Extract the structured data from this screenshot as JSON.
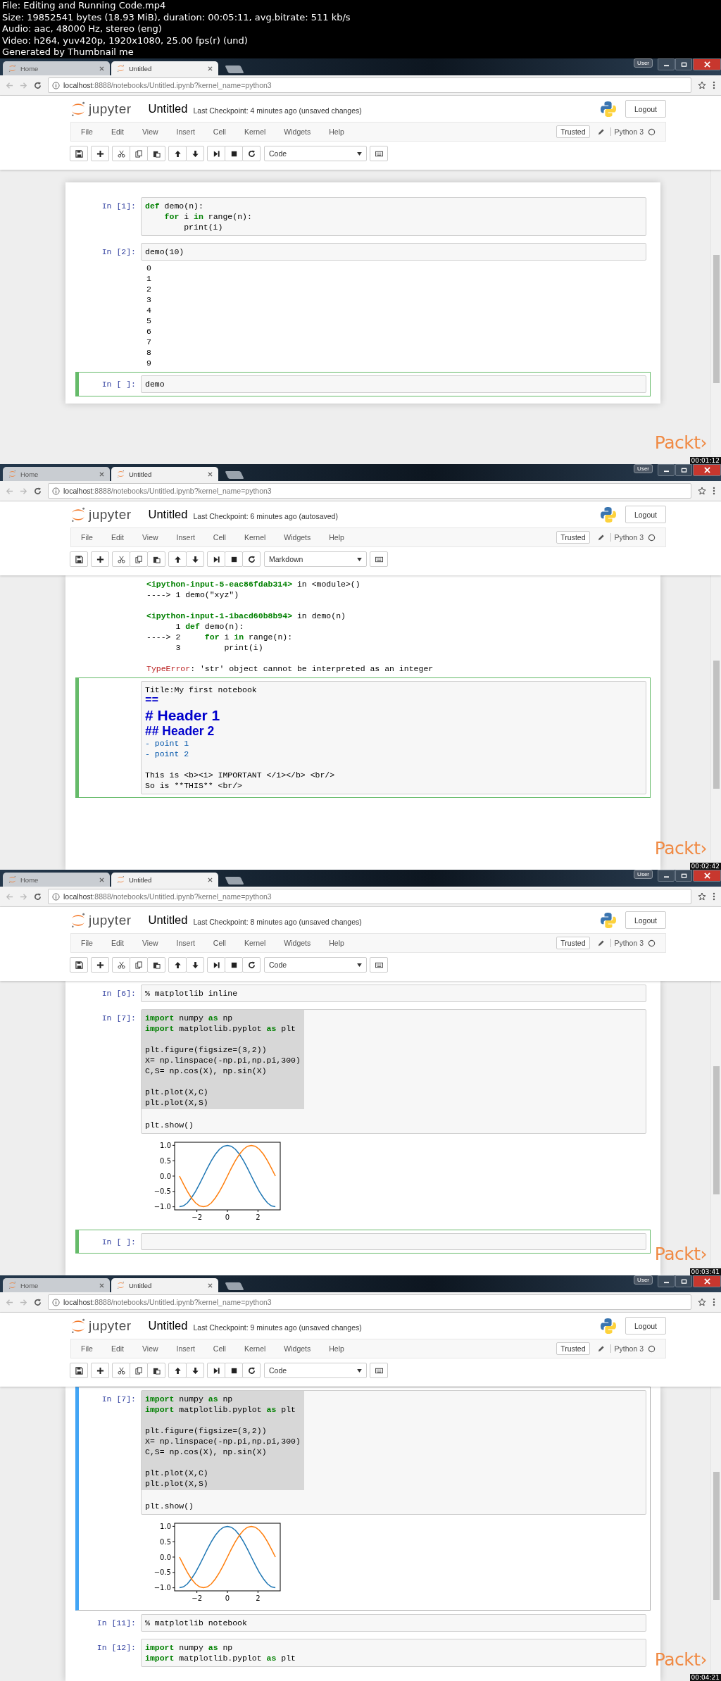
{
  "video_info": [
    "File: Editing and Running Code.mp4",
    "Size: 19852541 bytes (18.93 MiB), duration: 00:05:11, avg.bitrate: 511 kb/s",
    "Audio: aac, 48000 Hz, stereo (eng)",
    "Video: h264, yuv420p, 1920x1080, 25.00 fps(r) (und)",
    "Generated by Thumbnail me"
  ],
  "frames": [
    {
      "tabs": [
        {
          "label": "Home",
          "selected": false
        },
        {
          "label": "Untitled",
          "selected": true
        }
      ],
      "user_badge": "User",
      "url_host": "localhost",
      "url_rest": ":8888/notebooks/Untitled.ipynb?kernel_name=python3",
      "logo_text": "jupyter",
      "notebook_title": "Untitled",
      "checkpoint": "Last Checkpoint: 4 minutes ago (unsaved changes)",
      "logout": "Logout",
      "menu": [
        "File",
        "Edit",
        "View",
        "Insert",
        "Cell",
        "Kernel",
        "Widgets",
        "Help"
      ],
      "trusted": "Trusted",
      "kernel": "Python 3",
      "cell_type": "Code",
      "at_top": true,
      "cells": [
        {
          "prompt": "In [1]:",
          "selected": false,
          "input": {
            "kind": "code",
            "blocks": [
              [
                "**def** demo(n):",
                "    **for** i **in** range(n):",
                "        print(i)"
              ]
            ]
          }
        },
        {
          "prompt": "In [2]:",
          "selected": false,
          "input": {
            "kind": "code",
            "blocks": [
              [
                "demo(10)"
              ]
            ]
          },
          "output": {
            "kind": "stream",
            "lines": [
              "0",
              "1",
              "2",
              "3",
              "4",
              "5",
              "6",
              "7",
              "8",
              "9"
            ]
          }
        },
        {
          "prompt": "In [ ]:",
          "selected": true,
          "edit_mode": true,
          "input": {
            "kind": "code",
            "blocks": [
              [
                "demo"
              ]
            ]
          }
        }
      ],
      "brand": "Packt›",
      "timestamp": "00:01:12"
    },
    {
      "tabs": [
        {
          "label": "Home",
          "selected": false
        },
        {
          "label": "Untitled",
          "selected": true
        }
      ],
      "user_badge": "User",
      "url_host": "localhost",
      "url_rest": ":8888/notebooks/Untitled.ipynb?kernel_name=python3",
      "logo_text": "jupyter",
      "notebook_title": "Untitled",
      "checkpoint": "Last Checkpoint: 6 minutes ago (autosaved)",
      "logout": "Logout",
      "menu": [
        "File",
        "Edit",
        "View",
        "Insert",
        "Cell",
        "Kernel",
        "Widgets",
        "Help"
      ],
      "trusted": "Trusted",
      "kernel": "Python 3",
      "cell_type": "Markdown",
      "at_top": false,
      "cells": [
        {
          "selected": false,
          "output": {
            "kind": "traceback",
            "blocks": [
              [
                "**<ipython-input-5-eac86fdab314>** in <module>()",
                "----> 1 demo(\"xyz\")"
              ],
              [
                "**<ipython-input-1-1bacd60b8b94>** in demo(n)",
                "      1 **def** demo(n):",
                "----> 2     **for** i **in** range(n):",
                "      3         print(i)"
              ]
            ],
            "error_name": "TypeError",
            "error_message": ": 'str' object cannot be interpreted as an integer"
          }
        },
        {
          "selected": true,
          "edit_mode": true,
          "input": {
            "kind": "markdown",
            "blocks": [
              [
                {
                  "text": "Title:My first notebook",
                  "kind": "plain"
                },
                {
                  "text": "==",
                  "kind": "setext"
                },
                {
                  "text": "# Header 1",
                  "kind": "h1"
                },
                {
                  "text": "## Header 2",
                  "kind": "h2"
                },
                {
                  "text": "- point 1",
                  "kind": "list"
                },
                {
                  "text": "- point 2",
                  "kind": "list"
                }
              ],
              [
                {
                  "text": "This is <b><i> IMPORTANT </i></b> <br/>",
                  "kind": "plain"
                },
                {
                  "text": "So is **THIS** <br/>",
                  "kind": "plain"
                }
              ]
            ]
          }
        }
      ],
      "brand": "Packt›",
      "timestamp": "00:02:42"
    },
    {
      "tabs": [
        {
          "label": "Home",
          "selected": false
        },
        {
          "label": "Untitled",
          "selected": true
        }
      ],
      "user_badge": "User",
      "url_host": "localhost",
      "url_rest": ":8888/notebooks/Untitled.ipynb?kernel_name=python3",
      "logo_text": "jupyter",
      "notebook_title": "Untitled",
      "checkpoint": "Last Checkpoint: 8 minutes ago (unsaved changes)",
      "logout": "Logout",
      "menu": [
        "File",
        "Edit",
        "View",
        "Insert",
        "Cell",
        "Kernel",
        "Widgets",
        "Help"
      ],
      "trusted": "Trusted",
      "kernel": "Python 3",
      "cell_type": "Code",
      "at_top": false,
      "cells": [
        {
          "prompt": "In [6]:",
          "selected": false,
          "input": {
            "kind": "code",
            "blocks": [
              [
                "% matplotlib inline"
              ]
            ]
          }
        },
        {
          "prompt": "In [7]:",
          "selected": false,
          "input": {
            "kind": "code",
            "highlighted_blocks": [
              [
                "**import** numpy **as** np",
                "**import** matplotlib.pyplot **as** plt"
              ],
              [
                "plt.figure(figsize=(3,2))",
                "X= np.linspace(-np.pi,np.pi,300)",
                "C,S= np.cos(X), np.sin(X)"
              ],
              [
                "plt.plot(X,C)",
                "plt.plot(X,S)"
              ]
            ],
            "blocks": [
              [
                "plt.show()"
              ]
            ]
          },
          "output": {
            "kind": "chart",
            "chart_data": {
              "type": "line",
              "x": [
                -3.14,
                -2.88,
                -2.62,
                -2.36,
                -2.09,
                -1.83,
                -1.57,
                -1.31,
                -1.05,
                -0.79,
                -0.52,
                -0.26,
                0,
                0.26,
                0.52,
                0.79,
                1.05,
                1.31,
                1.57,
                1.83,
                2.09,
                2.36,
                2.62,
                2.88,
                3.14
              ],
              "series": [
                {
                  "color": "#1f77b4",
                  "values": [
                    -1,
                    -0.97,
                    -0.87,
                    -0.71,
                    -0.5,
                    -0.26,
                    0,
                    0.26,
                    0.5,
                    0.71,
                    0.87,
                    0.97,
                    1,
                    0.97,
                    0.87,
                    0.71,
                    0.5,
                    0.26,
                    0,
                    -0.26,
                    -0.5,
                    -0.71,
                    -0.87,
                    -0.97,
                    -1
                  ]
                },
                {
                  "color": "#ff7f0e",
                  "values": [
                    0,
                    -0.26,
                    -0.5,
                    -0.71,
                    -0.87,
                    -0.97,
                    -1,
                    -0.97,
                    -0.87,
                    -0.71,
                    -0.5,
                    -0.26,
                    0,
                    0.26,
                    0.5,
                    0.71,
                    0.87,
                    0.97,
                    1,
                    0.97,
                    0.87,
                    0.71,
                    0.5,
                    0.26,
                    0
                  ]
                }
              ],
              "xlim": [
                -3.46,
                3.46
              ],
              "ylim": [
                -1.1,
                1.1
              ],
              "xticks": [
                {
                  "value": -2,
                  "label": "−2"
                },
                {
                  "value": 0,
                  "label": "0"
                },
                {
                  "value": 2,
                  "label": "2"
                }
              ],
              "yticks": [
                {
                  "value": 1,
                  "label": "1.0"
                },
                {
                  "value": 0.5,
                  "label": "0.5"
                },
                {
                  "value": 0,
                  "label": "0.0"
                },
                {
                  "value": -0.5,
                  "label": "−0.5"
                },
                {
                  "value": -1,
                  "label": "−1.0"
                }
              ]
            }
          }
        },
        {
          "prompt": "In [ ]:",
          "selected": true,
          "edit_mode": true,
          "input": {
            "kind": "code"
          }
        }
      ],
      "brand": "Packt›",
      "timestamp": "00:03:41"
    },
    {
      "tabs": [
        {
          "label": "Home",
          "selected": false
        },
        {
          "label": "Untitled",
          "selected": true
        }
      ],
      "user_badge": "User",
      "url_host": "localhost",
      "url_rest": ":8888/notebooks/Untitled.ipynb?kernel_name=python3",
      "logo_text": "jupyter",
      "notebook_title": "Untitled",
      "checkpoint": "Last Checkpoint: 9 minutes ago (unsaved changes)",
      "logout": "Logout",
      "menu": [
        "File",
        "Edit",
        "View",
        "Insert",
        "Cell",
        "Kernel",
        "Widgets",
        "Help"
      ],
      "trusted": "Trusted",
      "kernel": "Python 3",
      "cell_type": "Code",
      "at_top": false,
      "cells": [
        {
          "prompt": "In [7]:",
          "selected": true,
          "edit_mode": false,
          "input": {
            "kind": "code",
            "highlighted_blocks": [
              [
                "**import** numpy **as** np",
                "**import** matplotlib.pyplot **as** plt"
              ],
              [
                "plt.figure(figsize=(3,2))",
                "X= np.linspace(-np.pi,np.pi,300)",
                "C,S= np.cos(X), np.sin(X)"
              ],
              [
                "plt.plot(X,C)",
                "plt.plot(X,S)"
              ]
            ],
            "blocks": [
              [
                "plt.show()"
              ]
            ]
          },
          "output": {
            "kind": "chart",
            "chart_data": {
              "type": "line",
              "x": [
                -3.14,
                -2.88,
                -2.62,
                -2.36,
                -2.09,
                -1.83,
                -1.57,
                -1.31,
                -1.05,
                -0.79,
                -0.52,
                -0.26,
                0,
                0.26,
                0.52,
                0.79,
                1.05,
                1.31,
                1.57,
                1.83,
                2.09,
                2.36,
                2.62,
                2.88,
                3.14
              ],
              "series": [
                {
                  "color": "#1f77b4",
                  "values": [
                    -1,
                    -0.97,
                    -0.87,
                    -0.71,
                    -0.5,
                    -0.26,
                    0,
                    0.26,
                    0.5,
                    0.71,
                    0.87,
                    0.97,
                    1,
                    0.97,
                    0.87,
                    0.71,
                    0.5,
                    0.26,
                    0,
                    -0.26,
                    -0.5,
                    -0.71,
                    -0.87,
                    -0.97,
                    -1
                  ]
                },
                {
                  "color": "#ff7f0e",
                  "values": [
                    0,
                    -0.26,
                    -0.5,
                    -0.71,
                    -0.87,
                    -0.97,
                    -1,
                    -0.97,
                    -0.87,
                    -0.71,
                    -0.5,
                    -0.26,
                    0,
                    0.26,
                    0.5,
                    0.71,
                    0.87,
                    0.97,
                    1,
                    0.97,
                    0.87,
                    0.71,
                    0.5,
                    0.26,
                    0
                  ]
                }
              ],
              "xlim": [
                -3.46,
                3.46
              ],
              "ylim": [
                -1.1,
                1.1
              ],
              "xticks": [
                {
                  "value": -2,
                  "label": "−2"
                },
                {
                  "value": 0,
                  "label": "0"
                },
                {
                  "value": 2,
                  "label": "2"
                }
              ],
              "yticks": [
                {
                  "value": 1,
                  "label": "1.0"
                },
                {
                  "value": 0.5,
                  "label": "0.5"
                },
                {
                  "value": 0,
                  "label": "0.0"
                },
                {
                  "value": -0.5,
                  "label": "−0.5"
                },
                {
                  "value": -1,
                  "label": "−1.0"
                }
              ]
            }
          }
        },
        {
          "prompt": "In [11]:",
          "selected": false,
          "input": {
            "kind": "code",
            "blocks": [
              [
                "% matplotlib notebook"
              ]
            ]
          }
        },
        {
          "prompt": "In [12]:",
          "selected": false,
          "input": {
            "kind": "code",
            "blocks": [
              [
                "**import** numpy **as** np",
                "**import** matplotlib.pyplot **as** plt"
              ]
            ]
          }
        }
      ],
      "brand": "Packt›",
      "timestamp": "00:04:21"
    }
  ]
}
